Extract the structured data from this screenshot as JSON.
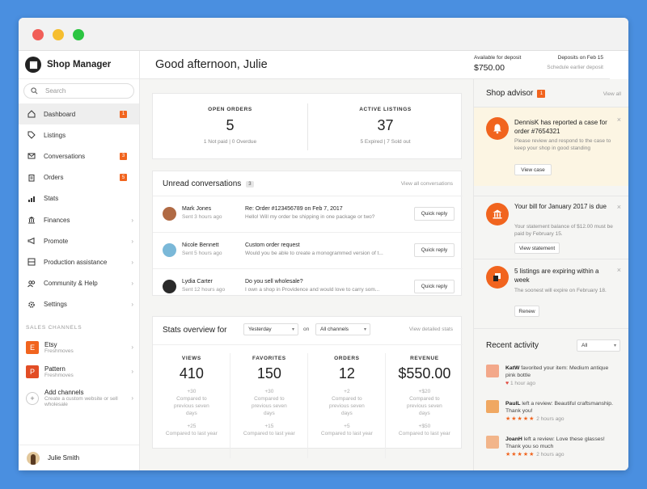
{
  "app": {
    "title": "Shop Manager"
  },
  "search": {
    "placeholder": "Search"
  },
  "nav": [
    {
      "label": "Dashboard",
      "badge": "1"
    },
    {
      "label": "Listings"
    },
    {
      "label": "Conversations",
      "badge": "3"
    },
    {
      "label": "Orders",
      "badge": "5"
    },
    {
      "label": "Stats"
    },
    {
      "label": "Finances"
    },
    {
      "label": "Promote"
    },
    {
      "label": "Production assistance"
    },
    {
      "label": "Community & Help"
    },
    {
      "label": "Settings"
    }
  ],
  "sales_channels": {
    "label": "SALES CHANNELS",
    "items": [
      {
        "logo": "E",
        "name": "Etsy",
        "sub": "Freshmoves",
        "color": "#f1641e"
      },
      {
        "logo": "P",
        "name": "Pattern",
        "sub": "Freshmoves",
        "color": "#e24d25"
      },
      {
        "logo": "+",
        "name": "Add channels",
        "sub": "Create a custom website or sell wholesale"
      }
    ]
  },
  "user": {
    "name": "Julie Smith"
  },
  "header": {
    "greeting": "Good afternoon, Julie",
    "available_label": "Available for deposit",
    "available_value": "$750.00",
    "deposit_label": "Deposits on Feb 15",
    "deposit_link": "Schedule earlier deposit"
  },
  "overview": {
    "open_orders": {
      "label": "OPEN ORDERS",
      "value": "5",
      "sub": "1 Not paid | 0 Overdue"
    },
    "active_listings": {
      "label": "ACTIVE LISTINGS",
      "value": "37",
      "sub": "5 Expired | 7 Sold out"
    }
  },
  "conversations": {
    "title": "Unread conversations",
    "count": "3",
    "view_all": "View all conversations",
    "reply_label": "Quick reply",
    "rows": [
      {
        "name": "Mark Jones",
        "time": "Sent 3 hours ago",
        "subject": "Re: Order #123456789 on Feb 7, 2017",
        "message": "Hello! Will my order be shipping in one package or two?",
        "avatar_color": "#b06a44"
      },
      {
        "name": "Nicole Bennett",
        "time": "Sent 5 hours ago",
        "subject": "Custom order request",
        "message": "Would you be able to create a monogrammed version of t...",
        "avatar_color": "#7ab8d8"
      },
      {
        "name": "Lydia Carter",
        "time": "Sent 12 hours ago",
        "subject": "Do you sell wholesale?",
        "message": "I own a shop in Providence and would love to carry som...",
        "avatar_color": "#2a2a2a"
      }
    ]
  },
  "stats": {
    "title": "Stats overview for",
    "period": "Yesterday",
    "on": "on",
    "channel": "All channels",
    "view_detailed": "View detailed stats",
    "columns": [
      {
        "label": "VIEWS",
        "value": "410",
        "prev_delta": "+30",
        "prev_text": "Compared to previous seven days",
        "year_delta": "+25",
        "year_text": "Compared to last year"
      },
      {
        "label": "FAVORITES",
        "value": "150",
        "prev_delta": "+30",
        "prev_text": "Compared to previous seven days",
        "year_delta": "+15",
        "year_text": "Compared to last year"
      },
      {
        "label": "ORDERS",
        "value": "12",
        "prev_delta": "+2",
        "prev_text": "Compared to previous seven days",
        "year_delta": "+5",
        "year_text": "Compared to last year"
      },
      {
        "label": "REVENUE",
        "value": "$550.00",
        "prev_delta": "+$20",
        "prev_text": "Compared to previous seven days",
        "year_delta": "+$50",
        "year_text": "Compared to last year"
      }
    ]
  },
  "advisor": {
    "title": "Shop advisor",
    "badge": "1",
    "view_all": "View all",
    "items": [
      {
        "icon": "bell-icon",
        "head": "DennisK has reported a case for order #7654321",
        "body": "Please review and respond to the case to keep your shop in good standing",
        "button": "View case"
      },
      {
        "icon": "bank-icon",
        "head": "Your bill for January 2017 is due",
        "body": "Your statement balance of $12.00 must be paid by February 15.",
        "button": "View statement"
      },
      {
        "icon": "listing-icon",
        "head": "5 listings are expiring within a week",
        "body": "The soonest will expire on February 18.",
        "button": "Renew"
      }
    ]
  },
  "recent": {
    "title": "Recent activity",
    "filter": "All",
    "items": [
      {
        "user": "KatW",
        "text": " favorited your item: Medium antique pink bottle",
        "meta": "1 hour ago",
        "kind": "heart",
        "thumb_color": "#f3a88a"
      },
      {
        "user": "PaulL",
        "text": " left a review: Beautiful craftsmanship. Thank you!",
        "meta": "2 hours ago",
        "kind": "stars",
        "rating": "★★★★★",
        "thumb_color": "#f0a862"
      },
      {
        "user": "JoanH",
        "text": " left a review: Love these glasses! Thank you so much",
        "meta": "2 hours ago",
        "kind": "stars",
        "rating": "★★★★★",
        "thumb_color": "#f2b58a"
      }
    ]
  },
  "colors": {
    "accent": "#f1641e",
    "page_bg": "#4a8fe0"
  }
}
